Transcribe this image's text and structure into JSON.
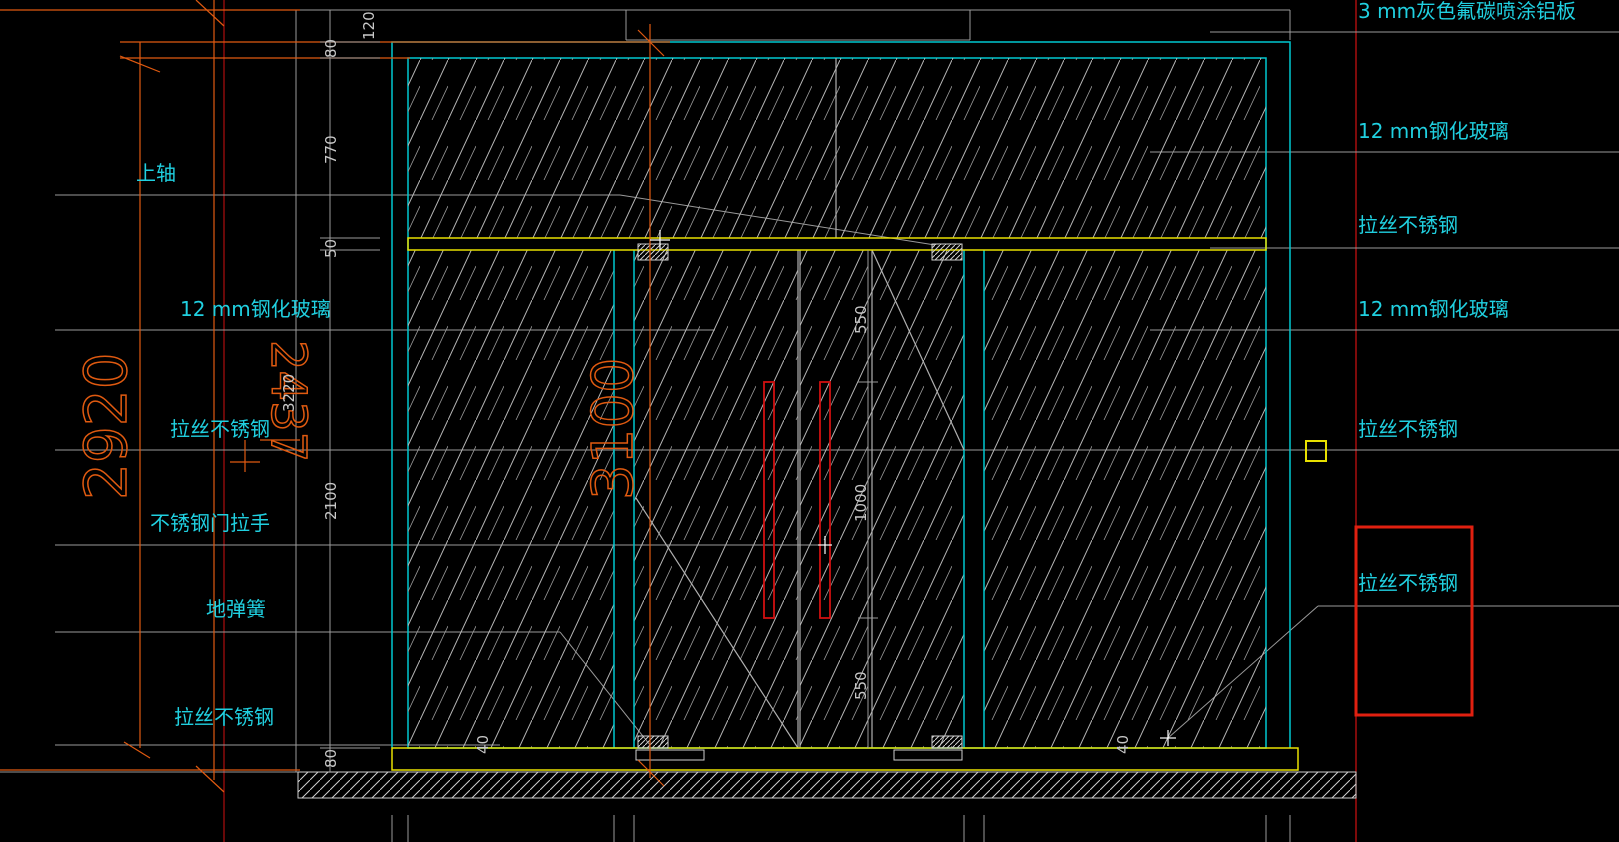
{
  "annotations": {
    "right": {
      "alu_panel": "3 mm灰色氟碳喷涂铝板",
      "glass_top": "12 mm钢化玻璃",
      "steel_1": "拉丝不锈钢",
      "glass_2": "12 mm钢化玻璃",
      "steel_2": "拉丝不锈钢",
      "steel_3": "拉丝不锈钢"
    },
    "left": {
      "top_pivot": "上轴",
      "glass": "12 mm钢化玻璃",
      "steel": "拉丝不锈钢",
      "handle": "不锈钢门拉手",
      "floor_spring": "地弹簧",
      "steel_bottom": "拉丝不锈钢"
    }
  },
  "dimensions": {
    "overall_2920": "2920",
    "overall_2437": "2437",
    "height_3100": "3100",
    "height_3220": "3220",
    "seg_120": "120",
    "seg_80_top": "80",
    "seg_770": "770",
    "seg_50": "50",
    "seg_2100": "2100",
    "seg_80_bottom": "80",
    "handle_550_top": "550",
    "handle_1000": "1000",
    "handle_550_bottom": "550",
    "gap_40_left": "40",
    "gap_40_right": "40"
  },
  "colors": {
    "background": "#000000",
    "frame_cyan": "#00c8d0",
    "transom_yellow": "#e8e000",
    "dimension_orange": "#e05a10",
    "handle_red": "#d01010",
    "label_cyan": "#20d0e0",
    "hatch_gray": "#bcbcbc",
    "highlight_red": "#e02010"
  }
}
